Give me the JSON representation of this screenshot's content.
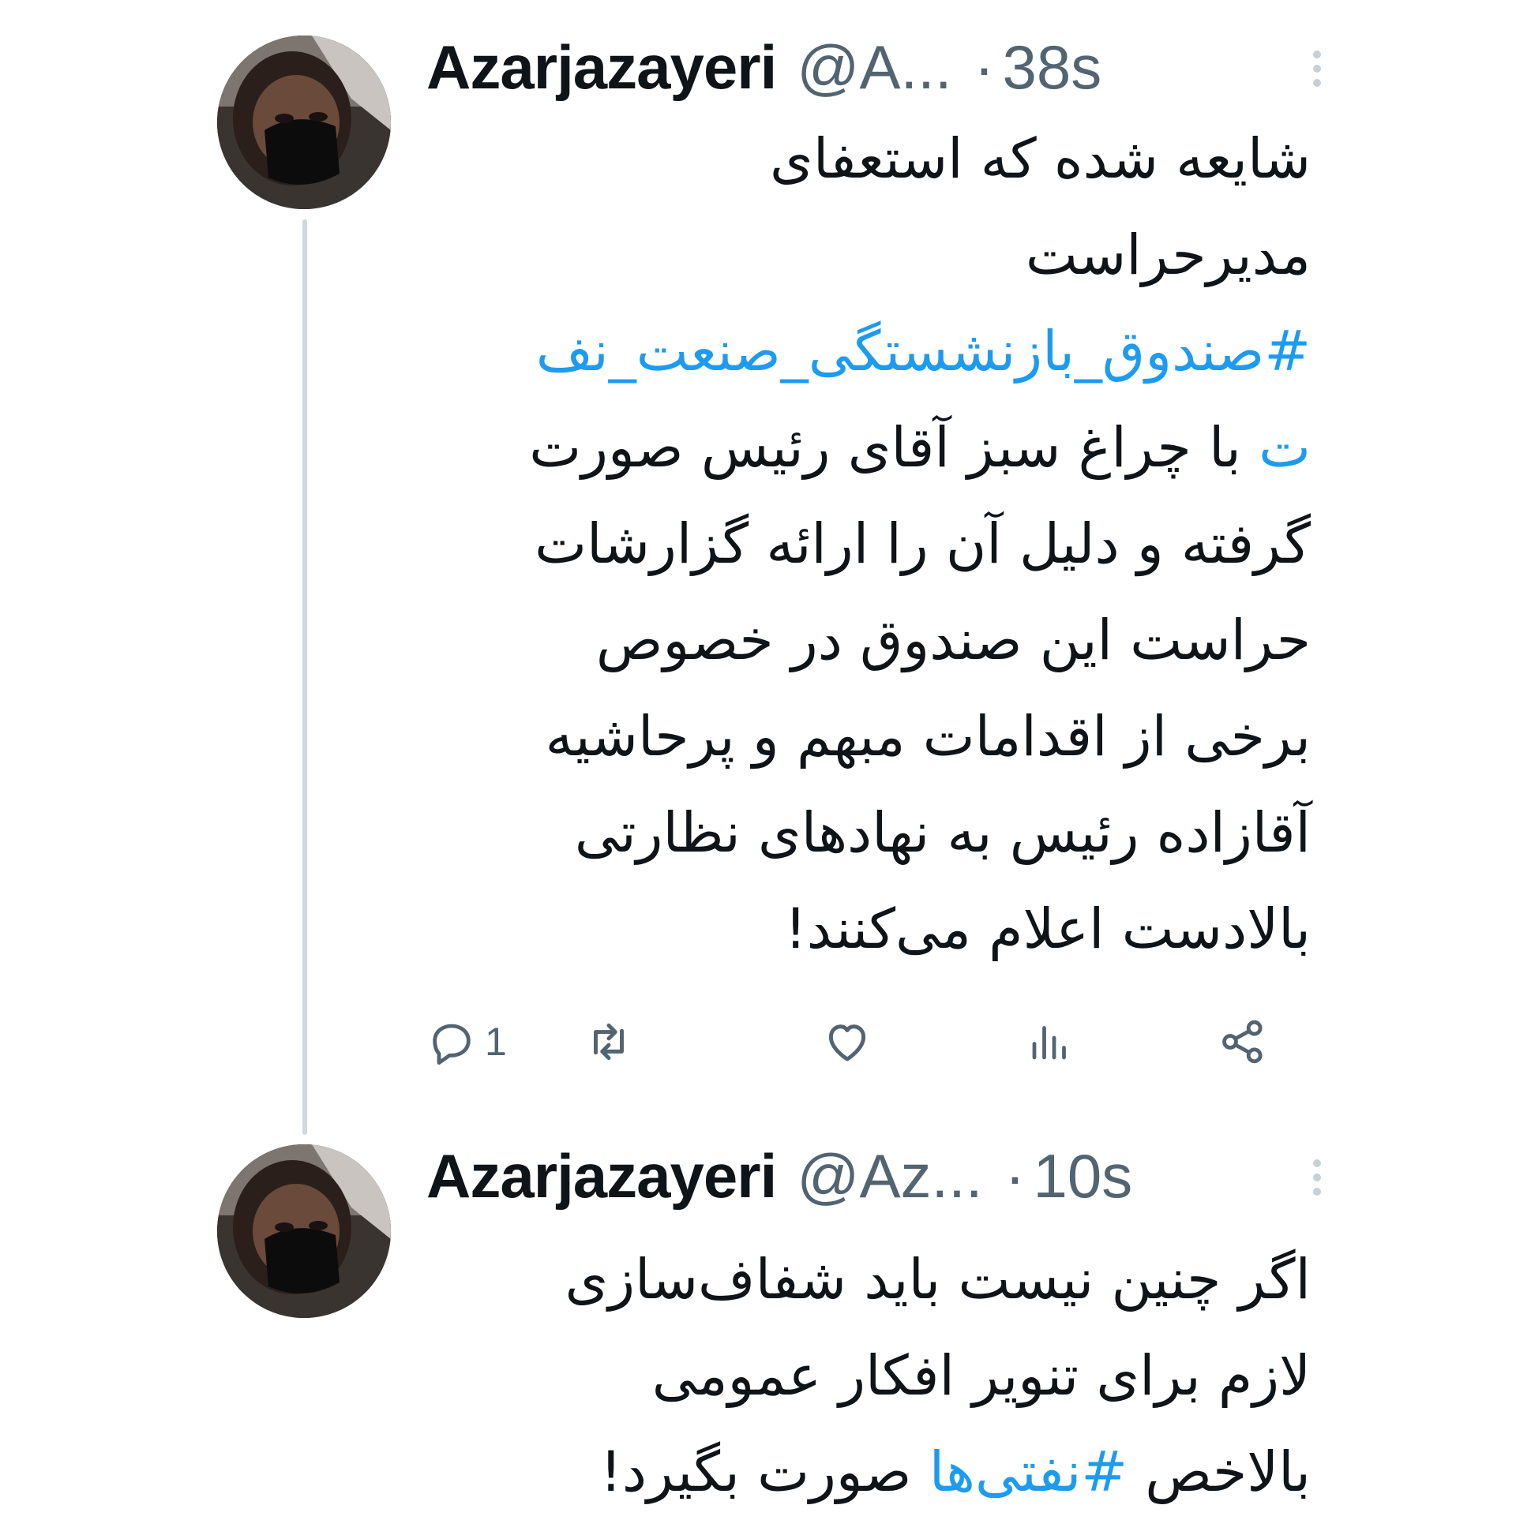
{
  "thread": {
    "tweets": [
      {
        "display_name": "Azarjazayeri",
        "handle": "@A...",
        "separator": "·",
        "time": "38s",
        "avatar": "user-avatar-photo",
        "body_lines": [
          {
            "text": "شایعه شده که استعفای"
          },
          {
            "text": "مدیرحراست"
          },
          {
            "prefix": "",
            "hashtag": "#صندوق_بازنشستگی_صنعت_نف"
          },
          {
            "hashtag": "ت",
            "suffix": " با چراغ سبز آقای رئیس صورت"
          },
          {
            "text": "گرفته و دلیل آن را ارائه گزارشات"
          },
          {
            "text": "حراست این صندوق در خصوص"
          },
          {
            "text": "برخی از اقدامات مبهم و پرحاشیه"
          },
          {
            "text": "آقازاده رئیس به نهادهای نظارتی"
          },
          {
            "text": "بالادست اعلام می‌کنند!"
          }
        ],
        "actions": {
          "reply_count": "1",
          "icons": [
            "reply-icon",
            "retweet-icon",
            "like-icon",
            "views-icon",
            "share-icon"
          ]
        }
      },
      {
        "display_name": "Azarjazayeri",
        "handle": "@Az...",
        "separator": "·",
        "time": "10s",
        "avatar": "user-avatar-photo",
        "body_lines": [
          {
            "text": "اگر چنین نیست باید شفاف‌سازی"
          },
          {
            "text": "لازم برای تنویر افکار عمومی"
          },
          {
            "prefix": "بالاخص ",
            "hashtag": "#نفتی‌ها",
            "suffix": " صورت بگیرد!"
          }
        ]
      }
    ]
  },
  "colors": {
    "text": "#0f1419",
    "secondary": "#536471",
    "link": "#1d9bf0",
    "thread_line": "#cfd9de"
  }
}
